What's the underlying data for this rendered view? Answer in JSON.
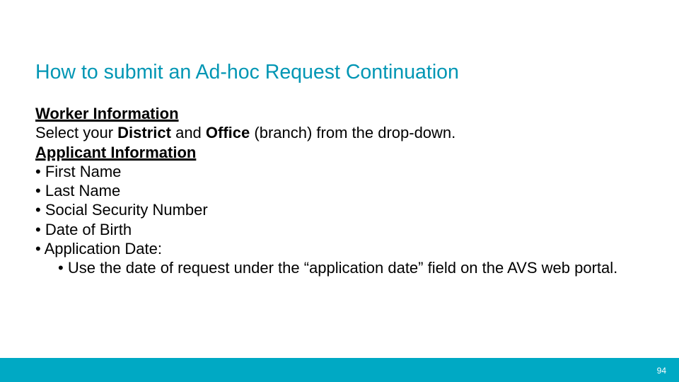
{
  "title": "How to submit an Ad-hoc Request Continuation",
  "section1": "Worker Information",
  "line1_a": "Select your ",
  "line1_b": "District",
  "line1_c": " and ",
  "line1_d": "Office",
  "line1_e": " (branch) from the drop-down.",
  "section2": "Applicant Information",
  "b1": "First Name",
  "b2": "Last Name",
  "b3": "Social Security Number",
  "b4": "Date of Birth",
  "b5": "Application Date:",
  "sub1": "Use the date of request under the “application date” field on the AVS web portal.",
  "page": "94"
}
